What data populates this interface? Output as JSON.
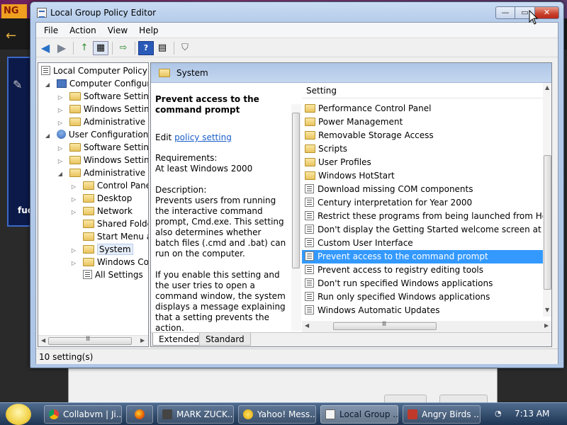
{
  "window": {
    "title": "Local Group Policy Editor",
    "minimize_glyph": "—",
    "maximize_glyph": "▭",
    "close_glyph": "✕"
  },
  "menubar": {
    "items": [
      "File",
      "Action",
      "View",
      "Help"
    ]
  },
  "toolbar": {
    "back_glyph": "◀",
    "forward_glyph": "▶",
    "up_glyph": "↑",
    "showhide_glyph": "▦",
    "export_glyph": "⇨",
    "help_glyph": "?",
    "properties_glyph": "▤",
    "filter_glyph": "⛉"
  },
  "tree": {
    "expand_open": "◢",
    "expand_closed": "▷",
    "items": [
      {
        "label": "Local Computer Policy"
      },
      {
        "label": "Computer Configura"
      },
      {
        "label": "Software Settings"
      },
      {
        "label": "Windows Setting"
      },
      {
        "label": "Administrative Te"
      },
      {
        "label": "User Configuration"
      },
      {
        "label": "Software Settings"
      },
      {
        "label": "Windows Setting"
      },
      {
        "label": "Administrative Te"
      },
      {
        "label": "Control Panel"
      },
      {
        "label": "Desktop"
      },
      {
        "label": "Network"
      },
      {
        "label": "Shared Folder"
      },
      {
        "label": "Start Menu ar"
      },
      {
        "label": "System"
      },
      {
        "label": "Windows Cor"
      },
      {
        "label": "All Settings"
      }
    ],
    "scroll_thumb_glyph": "Ⅲ"
  },
  "detail": {
    "header_title": "System",
    "explain": {
      "heading": "Prevent access to the command prompt",
      "edit_prefix": "Edit ",
      "edit_link": "policy setting",
      "requirements_label": "Requirements:",
      "requirements_value": "At least Windows 2000",
      "description_label": "Description:",
      "description_text": "Prevents users from running the interactive command prompt, Cmd.exe. This setting also determines whether batch files (.cmd and .bat) can run on the computer.",
      "description_text2": "If you enable this setting and the user tries to open a command window, the system displays a message explaining that a setting prevents the action."
    },
    "list": {
      "column_header": "Setting",
      "rows": [
        {
          "label": "Performance Control Panel",
          "kind": "folder"
        },
        {
          "label": "Power Management",
          "kind": "folder"
        },
        {
          "label": "Removable Storage Access",
          "kind": "folder"
        },
        {
          "label": "Scripts",
          "kind": "folder"
        },
        {
          "label": "User Profiles",
          "kind": "folder"
        },
        {
          "label": "Windows HotStart",
          "kind": "folder"
        },
        {
          "label": "Download missing COM components",
          "kind": "setting"
        },
        {
          "label": "Century interpretation for Year 2000",
          "kind": "setting"
        },
        {
          "label": "Restrict these programs from being launched from Help",
          "kind": "setting"
        },
        {
          "label": "Don't display the Getting Started welcome screen at logon",
          "kind": "setting"
        },
        {
          "label": "Custom User Interface",
          "kind": "setting"
        },
        {
          "label": "Prevent access to the command prompt",
          "kind": "setting"
        },
        {
          "label": "Prevent access to registry editing tools",
          "kind": "setting"
        },
        {
          "label": "Don't run specified Windows applications",
          "kind": "setting"
        },
        {
          "label": "Run only specified Windows applications",
          "kind": "setting"
        },
        {
          "label": "Windows Automatic Updates",
          "kind": "setting"
        }
      ],
      "scroll_thumb_glyph": "Ⅲ"
    },
    "tabs": {
      "extended": "Extended",
      "standard": "Standard"
    }
  },
  "status": {
    "text": "10 setting(s)"
  },
  "taskbar": {
    "items": [
      {
        "label": "Collabvm | Ji..."
      },
      {
        "label": ""
      },
      {
        "label": "MARK ZUCK..."
      },
      {
        "label": "Yahoo! Mess..."
      },
      {
        "label": "Local Group ..."
      },
      {
        "label": "Angry Birds ..."
      }
    ],
    "clock": "7:13 AM",
    "tray_glyph": "◔"
  },
  "background": {
    "logo_text": "NG",
    "fuc_text": "fuc",
    "back_glyph": "←",
    "card_glyph": "✎"
  },
  "colors": {
    "selection": "#3399ff",
    "link": "#1a5ec8",
    "close_button": "#c8402a"
  }
}
